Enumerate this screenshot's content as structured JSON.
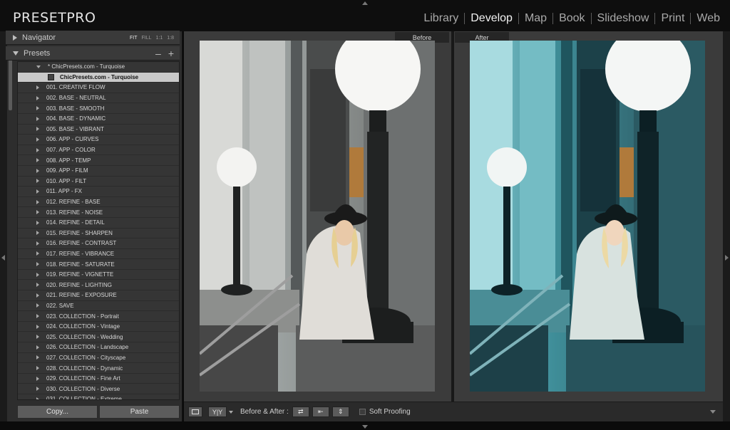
{
  "app": {
    "brand": "PRESETPRO"
  },
  "modules": [
    {
      "label": "Library",
      "active": false
    },
    {
      "label": "Develop",
      "active": true
    },
    {
      "label": "Map",
      "active": false
    },
    {
      "label": "Book",
      "active": false
    },
    {
      "label": "Slideshow",
      "active": false
    },
    {
      "label": "Print",
      "active": false
    },
    {
      "label": "Web",
      "active": false
    }
  ],
  "navigator": {
    "title": "Navigator",
    "zoom_options": [
      "FIT",
      "FILL",
      "1:1",
      "1:8"
    ],
    "active_zoom": "FIT"
  },
  "presets": {
    "title": "Presets",
    "minus": "–",
    "plus": "+",
    "items": [
      {
        "label": "* ChicPresets.com - Turquoise",
        "kind": "open"
      },
      {
        "label": "ChicPresets.com - Turquoise",
        "kind": "selected"
      },
      {
        "label": "001. CREATIVE FLOW",
        "kind": "folder"
      },
      {
        "label": "002. BASE - NEUTRAL",
        "kind": "folder"
      },
      {
        "label": "003. BASE - SMOOTH",
        "kind": "folder"
      },
      {
        "label": "004. BASE - DYNAMIC",
        "kind": "folder"
      },
      {
        "label": "005. BASE - VIBRANT",
        "kind": "folder"
      },
      {
        "label": "006. APP - CURVES",
        "kind": "folder"
      },
      {
        "label": "007. APP - COLOR",
        "kind": "folder"
      },
      {
        "label": "008. APP - TEMP",
        "kind": "folder"
      },
      {
        "label": "009. APP - FILM",
        "kind": "folder"
      },
      {
        "label": "010. APP - FILT",
        "kind": "folder"
      },
      {
        "label": "011. APP - FX",
        "kind": "folder"
      },
      {
        "label": "012. REFINE - BASE",
        "kind": "folder"
      },
      {
        "label": "013. REFINE - NOISE",
        "kind": "folder"
      },
      {
        "label": "014. REFINE - DETAIL",
        "kind": "folder"
      },
      {
        "label": "015. REFINE - SHARPEN",
        "kind": "folder"
      },
      {
        "label": "016. REFINE - CONTRAST",
        "kind": "folder"
      },
      {
        "label": "017. REFINE - VIBRANCE",
        "kind": "folder"
      },
      {
        "label": "018. REFINE - SATURATE",
        "kind": "folder"
      },
      {
        "label": "019. REFINE - VIGNETTE",
        "kind": "folder"
      },
      {
        "label": "020. REFINE - LIGHTING",
        "kind": "folder"
      },
      {
        "label": "021. REFINE - EXPOSURE",
        "kind": "folder"
      },
      {
        "label": "022. SAVE",
        "kind": "folder"
      },
      {
        "label": "023. COLLECTION - Portrait",
        "kind": "folder"
      },
      {
        "label": "024. COLLECTION - Vintage",
        "kind": "folder"
      },
      {
        "label": "025. COLLECTION - Wedding",
        "kind": "folder"
      },
      {
        "label": "026. COLLECTION - Landscape",
        "kind": "folder"
      },
      {
        "label": "027. COLLECTION - Cityscape",
        "kind": "folder"
      },
      {
        "label": "028. COLLECTION - Dynamic",
        "kind": "folder"
      },
      {
        "label": "029. COLLECTION - Fine Art",
        "kind": "folder"
      },
      {
        "label": "030. COLLECTION - Diverse",
        "kind": "folder"
      },
      {
        "label": "031. COLLECTION - Extreme",
        "kind": "folder"
      }
    ]
  },
  "left_buttons": {
    "copy": "Copy...",
    "paste": "Paste"
  },
  "views": {
    "before": "Before",
    "after": "After"
  },
  "toolbar": {
    "yy_label": "Y|Y",
    "before_after_label": "Before & After :",
    "swap_1": "⇄",
    "swap_2": "⇤",
    "swap_3": "⇕",
    "soft_proofing": "Soft Proofing"
  },
  "colors": {
    "accent_after_tint": "#3aa6b0",
    "panel_bg": "#2d2d2d",
    "main_bg": "#3b3b3b"
  }
}
